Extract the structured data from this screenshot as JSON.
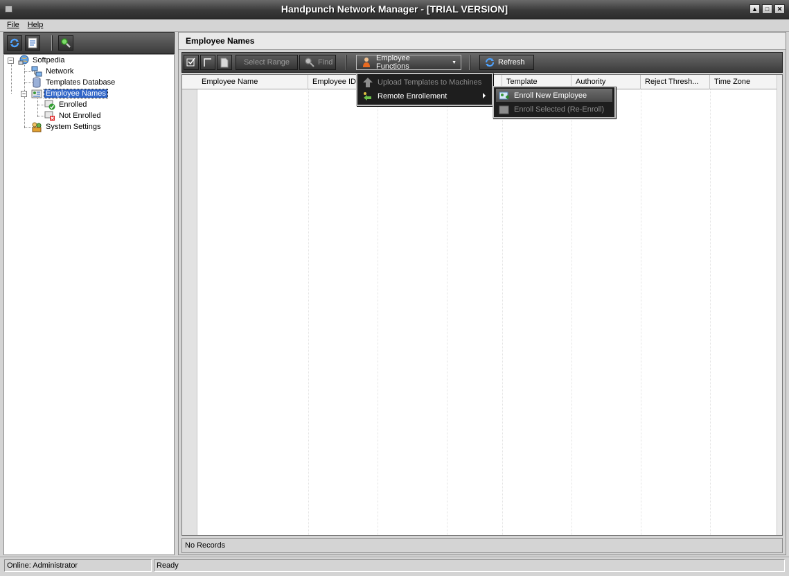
{
  "window": {
    "title": "Handpunch Network Manager - [TRIAL VERSION]",
    "minimize": "▲",
    "maximize": "□",
    "close": "✕"
  },
  "menubar": {
    "file": "File",
    "help": "Help"
  },
  "tree": {
    "root": "Softpedia",
    "network": "Network",
    "templates_db": "Templates Database",
    "employee_names": "Employee Names",
    "enrolled": "Enrolled",
    "not_enrolled": "Not Enrolled",
    "system_settings": "System Settings"
  },
  "panel": {
    "title": "Employee Names"
  },
  "grid_toolbar": {
    "select_range": "Select Range",
    "find": "Find",
    "employee_functions": "Employee Functions",
    "refresh": "Refresh"
  },
  "grid": {
    "columns": [
      "Employee Name",
      "Employee ID",
      "",
      "",
      "Template",
      "Authority",
      "Reject Thresh...",
      "Time Zone"
    ],
    "footer": "No Records"
  },
  "employee_functions_menu": {
    "upload_templates": "Upload Templates to Machines",
    "remote_enrollment": "Remote Enrollement"
  },
  "remote_enrollment_menu": {
    "enroll_new": "Enroll New Employee",
    "enroll_selected": "Enroll Selected (Re-Enroll)"
  },
  "status": {
    "online": "Online: Administrator",
    "state": "Ready"
  },
  "colors": {
    "selection": "#3166c8",
    "toolbar_dark": "#3c3c3c"
  }
}
